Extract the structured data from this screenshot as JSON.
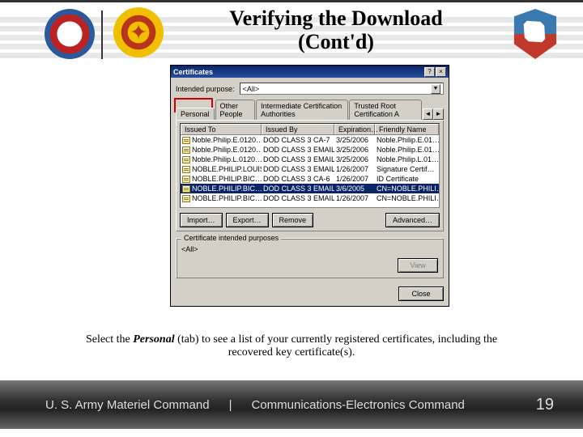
{
  "title_line1": "Verifying the Download",
  "title_line2": "(Cont'd)",
  "dialog": {
    "title": "Certificates",
    "help_btn": "?",
    "close_btn": "×",
    "purpose_label": "Intended purpose:",
    "purpose_value": "<All>",
    "tabs": [
      "Personal",
      "Other People",
      "Intermediate Certification Authorities",
      "Trusted Root Certification A"
    ],
    "scroll_left": "◄",
    "scroll_right": "►",
    "columns": [
      "Issued To",
      "Issued By",
      "Expiration…",
      "Friendly Name"
    ],
    "rows": [
      {
        "to": "Noble.Philip.E.0120…",
        "by": "DOD CLASS 3 CA-7",
        "exp": "3/25/2006",
        "fn": "Noble.Philip.E.01…"
      },
      {
        "to": "Noble.Philip.E.0120…",
        "by": "DOD CLASS 3 EMAIL…",
        "exp": "3/25/2006",
        "fn": "Noble.Philip.E.01…"
      },
      {
        "to": "Noble.Philip.L.0120…",
        "by": "DOD CLASS 3 EMAIL…",
        "exp": "3/25/2006",
        "fn": "Noble.Philip.L.01…"
      },
      {
        "to": "NOBLE.PHILIP.LOUIS…",
        "by": "DOD CLASS 3 EMAIL…",
        "exp": "1/26/2007",
        "fn": "Signature Certif…"
      },
      {
        "to": "NOBLE.PHILIP.BIC…",
        "by": "DOD CLASS 3 CA-6",
        "exp": "1/26/2007",
        "fn": "ID Certificate"
      },
      {
        "to": "NOBLE.PHILIP.BIC…",
        "by": "DOD CLASS 3 EMAIL…",
        "exp": "3/6/2005",
        "fn": "CN=NOBLE.PHILI…",
        "sel": true
      },
      {
        "to": "NOBLE.PHILIP.BIC…",
        "by": "DOD CLASS 3 EMAIL…",
        "exp": "1/26/2007",
        "fn": "CN=NOBLE.PHILI…"
      }
    ],
    "buttons": {
      "import": "Import…",
      "export": "Export…",
      "remove": "Remove",
      "advanced": "Advanced…"
    },
    "fieldset_label": "Certificate intended purposes",
    "fieldset_value": "<All>",
    "view_btn": "View",
    "close_dlg": "Close"
  },
  "caption_pre": "Select the ",
  "caption_emph": "Personal",
  "caption_post": " (tab) to see a list of your currently registered certificates, including the recovered key certificate(s).",
  "footer": {
    "left": "U. S. Army Materiel Command",
    "sep": "|",
    "right": "Communications-Electronics Command",
    "page": "19"
  }
}
